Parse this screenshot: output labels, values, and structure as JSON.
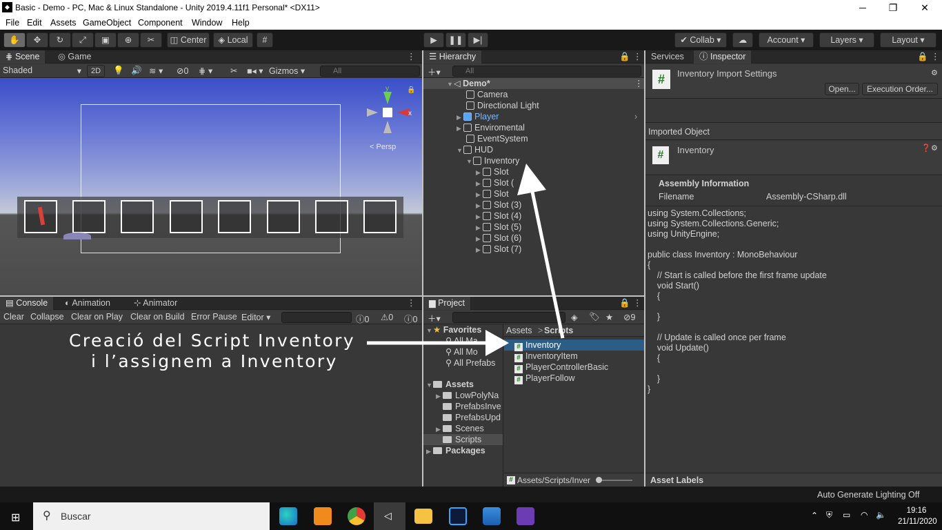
{
  "window": {
    "title": "Basic - Demo - PC, Mac & Linux Standalone - Unity 2019.4.11f1 Personal* <DX11>",
    "minimize": "─",
    "restore": "❐",
    "close": "✕"
  },
  "menu": [
    "File",
    "Edit",
    "Assets",
    "GameObject",
    "Component",
    "Window",
    "Help"
  ],
  "toolbar": {
    "center": "Center",
    "local": "Local",
    "collab": "Collab",
    "account": "Account",
    "layers": "Layers",
    "layout": "Layout"
  },
  "scene": {
    "tabs": [
      "Scene",
      "Game"
    ],
    "shading": "Shaded",
    "mode_2d": "2D",
    "hidden_count": "0",
    "gizmos": "Gizmos",
    "search_placeholder": "All",
    "persp": "Persp"
  },
  "console": {
    "tabs": [
      "Console",
      "Animation",
      "Animator"
    ],
    "buttons": [
      "Clear",
      "Collapse",
      "Clear on Play",
      "Clear on Build",
      "Error Pause",
      "Editor"
    ],
    "counts": [
      "0",
      "0",
      "0"
    ]
  },
  "hierarchy": {
    "tab": "Hierarchy",
    "search_placeholder": "All",
    "scene_name": "Demo*",
    "items": [
      "Camera",
      "Directional Light",
      "Player",
      "Enviromental",
      "EventSystem",
      "HUD",
      "Inventory"
    ],
    "slots": [
      "Slot",
      "Slot (",
      "Slot",
      "Slot (3)",
      "Slot (4)",
      "Slot (5)",
      "Slot (6)",
      "Slot (7)"
    ]
  },
  "project": {
    "tab": "Project",
    "hidden_count": "9",
    "favorites_label": "Favorites",
    "favorites": [
      "All Ma",
      "All Mo",
      "All Prefabs"
    ],
    "assets_label": "Assets",
    "asset_folders": [
      "LowPolyNa",
      "PrefabsInve",
      "PrefabsUpd",
      "Scenes",
      "Scripts"
    ],
    "packages_label": "Packages",
    "breadcrumb_root": "Assets",
    "breadcrumb_sep": ">",
    "breadcrumb_current": "Scripts",
    "files": [
      "Inventory",
      "InventoryItem",
      "PlayerControllerBasic",
      "PlayerFollow"
    ],
    "footer_path": "Assets/Scripts/Inver"
  },
  "inspector": {
    "tabs": [
      "Services",
      "Inspector"
    ],
    "header_title": "Inventory Import Settings",
    "open_button": "Open...",
    "execution_order_button": "Execution Order...",
    "imported_object": "Imported Object",
    "object_name": "Inventory",
    "assembly_info": "Assembly Information",
    "filename_label": "Filename",
    "filename_value": "Assembly-CSharp.dll",
    "code": "using System.Collections;\nusing System.Collections.Generic;\nusing UnityEngine;\n\npublic class Inventory : MonoBehaviour\n{\n    // Start is called before the first frame update\n    void Start()\n    {\n\n    }\n\n    // Update is called once per frame\n    void Update()\n    {\n\n    }\n}",
    "asset_labels": "Asset Labels"
  },
  "annotation": {
    "line1": "Creació del Script Inventory",
    "line2": "i l’assignem a Inventory"
  },
  "status": {
    "lighting": "Auto Generate Lighting Off"
  },
  "taskbar": {
    "search_placeholder": "Buscar",
    "time": "19:16",
    "date": "21/11/2020"
  },
  "colors": {
    "selection": "#2c5d87",
    "player_blue": "#7cb8ff",
    "taskbar": "#101010"
  }
}
